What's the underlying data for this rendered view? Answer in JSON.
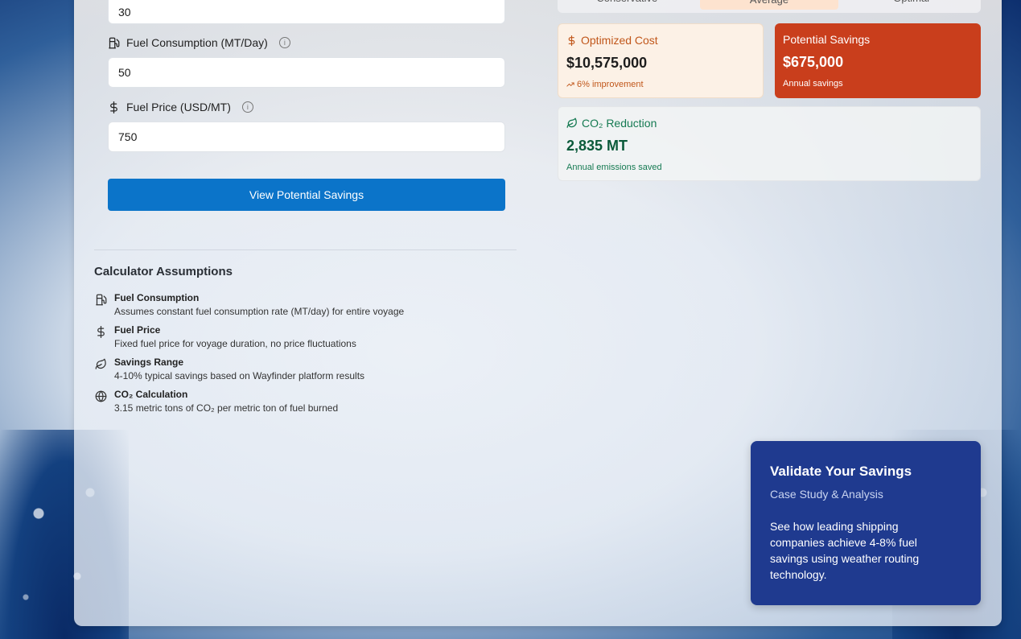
{
  "inputs": {
    "top_value": "30",
    "fuel_consumption": {
      "label": "Fuel Consumption (MT/Day)",
      "value": "50"
    },
    "fuel_price": {
      "label": "Fuel Price (USD/MT)",
      "value": "750"
    }
  },
  "primary_button": "View Potential Savings",
  "assumptions": {
    "title": "Calculator Assumptions",
    "items": [
      {
        "icon": "fuel-pump-icon",
        "heading": "Fuel Consumption",
        "desc": "Assumes constant fuel consumption rate (MT/day) for entire voyage"
      },
      {
        "icon": "dollar-icon",
        "heading": "Fuel Price",
        "desc": "Fixed fuel price for voyage duration, no price fluctuations"
      },
      {
        "icon": "leaf-icon",
        "heading": "Savings Range",
        "desc": "4-10% typical savings based on Wayfinder platform results"
      },
      {
        "icon": "globe-icon",
        "heading": "CO₂ Calculation",
        "desc": "3.15 metric tons of CO₂ per metric ton of fuel burned"
      }
    ]
  },
  "tabs": [
    "Conservative",
    "Average",
    "Optimal"
  ],
  "active_tab": "Average",
  "cards": {
    "optimized_cost": {
      "title": "Optimized Cost",
      "value": "$10,575,000",
      "sub": "6% improvement"
    },
    "potential_savings": {
      "title": "Potential Savings",
      "value": "$675,000",
      "sub": "Annual savings"
    },
    "co2_reduction": {
      "title": "CO₂ Reduction",
      "value": "2,835 MT",
      "sub": "Annual emissions saved"
    }
  },
  "validate": {
    "title": "Validate Your Savings",
    "subtitle": "Case Study & Analysis",
    "desc": "See how leading shipping companies achieve 4-8% fuel savings using weather routing technology."
  },
  "colors": {
    "primary": "#0b74c9",
    "savings": "#c93e1c",
    "cost_accent": "#c1571b",
    "co2_accent": "#157a52",
    "validate_bg": "#1f3a8f"
  }
}
